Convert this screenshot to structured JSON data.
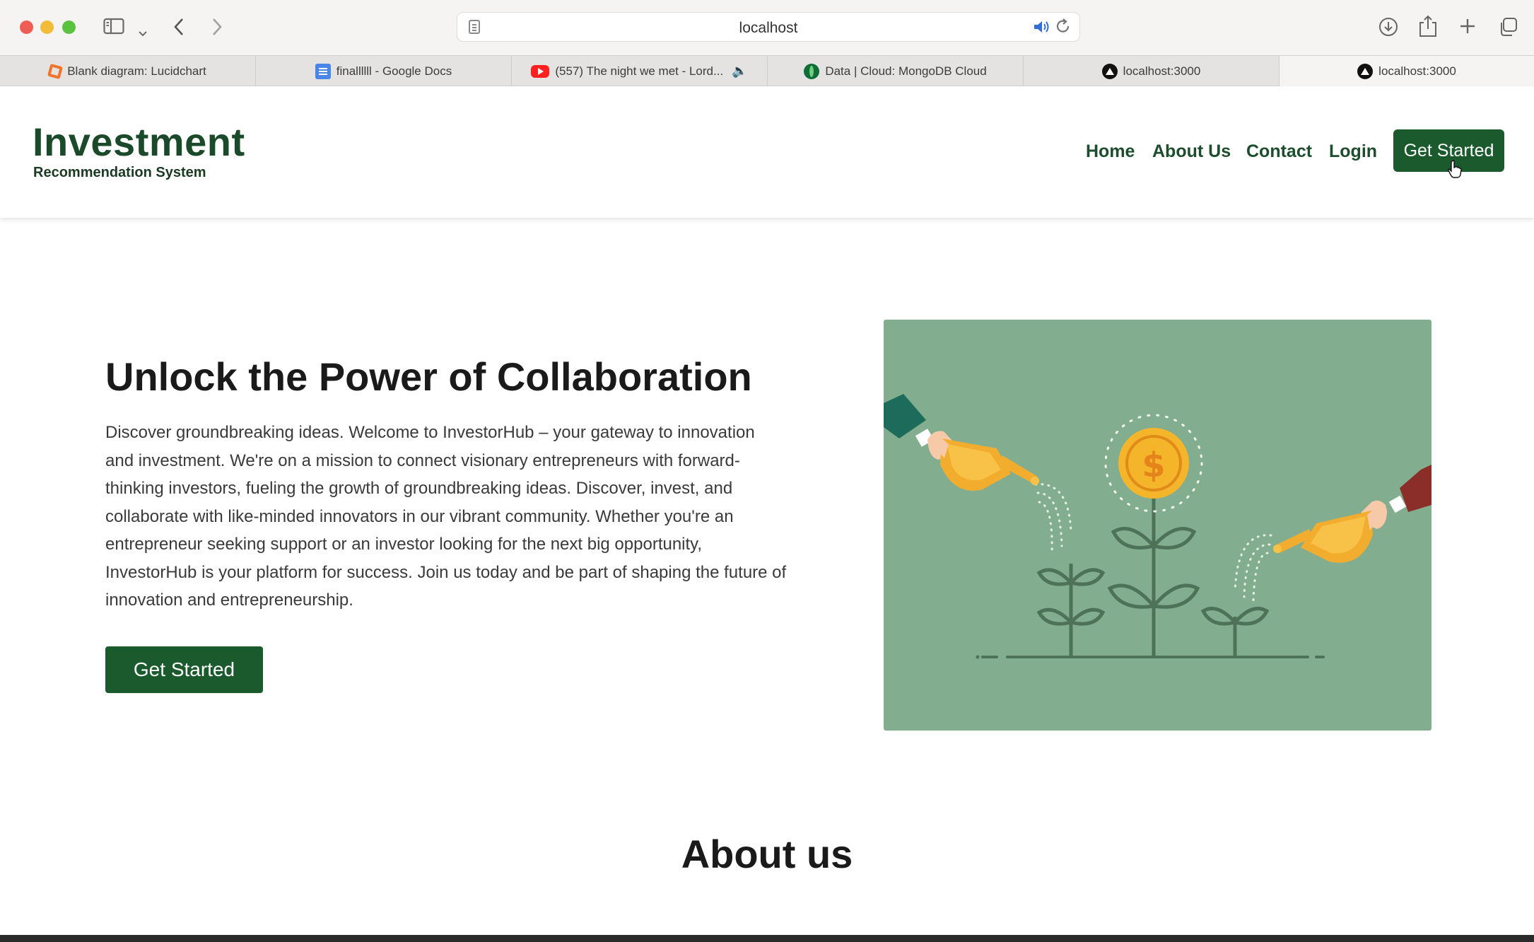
{
  "browser": {
    "url": "localhost",
    "tabs": [
      {
        "label": "Blank diagram: Lucidchart",
        "favicon": "lucidchart-icon"
      },
      {
        "label": "finallllll - Google Docs",
        "favicon": "google-docs-icon"
      },
      {
        "label": "(557) The night we met - Lord...",
        "favicon": "youtube-icon",
        "muted_indicator": "speaker-icon"
      },
      {
        "label": "Data | Cloud: MongoDB Cloud",
        "favicon": "mongodb-icon"
      },
      {
        "label": "localhost:3000",
        "favicon": "vercel-icon"
      },
      {
        "label": "localhost:3000",
        "favicon": "vercel-icon",
        "active": true
      }
    ]
  },
  "header": {
    "logo_title": "Investment",
    "logo_subtitle": "Recommendation System",
    "nav": {
      "home": "Home",
      "about": "About Us",
      "contact": "Contact",
      "login": "Login",
      "cta": "Get Started"
    }
  },
  "hero": {
    "title": "Unlock the Power of Collaboration",
    "body": "Discover groundbreaking ideas. Welcome to InvestorHub – your gateway to innovation and investment. We're on a mission to connect visionary entrepreneurs with forward-thinking investors, fueling the growth of groundbreaking ideas. Discover, invest, and collaborate with like-minded innovators in our vibrant community. Whether you're an entrepreneur seeking support or an investor looking for the next big opportunity, InvestorHub is your platform for success. Join us today and be part of shaping the future of innovation and entrepreneurship.",
    "cta": "Get Started",
    "illustration": "money-plant-watering-illustration",
    "coin_symbol": "$"
  },
  "about": {
    "title": "About us"
  },
  "colors": {
    "brand_green": "#1a5a2c",
    "illustration_bg": "#82ae8f",
    "coin_gold": "#f4b52a"
  }
}
